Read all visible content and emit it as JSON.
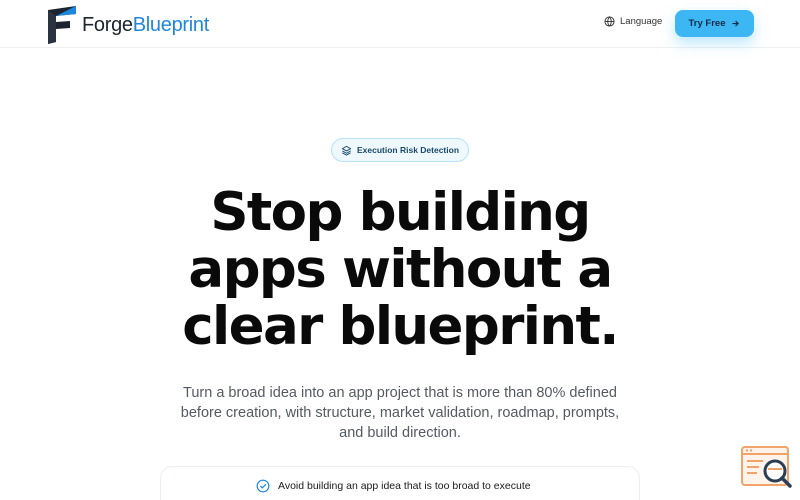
{
  "header": {
    "logo": {
      "part1": "Forge",
      "part2": "Blueprint"
    },
    "language_label": "Language",
    "cta_label": "Try Free"
  },
  "hero": {
    "badge_label": "Execution Risk Detection",
    "headline_lines": [
      "Stop building",
      "apps without a",
      "clear blueprint."
    ],
    "subtext_lines": [
      "Turn a broad idea into an app project that is more than 80% defined",
      "before creation, with structure, market validation, roadmap, prompts,",
      "and build direction."
    ]
  },
  "features": {
    "items": [
      "Avoid building an app idea that is too broad to execute"
    ]
  },
  "colors": {
    "brand_blue": "#1b88dd",
    "cta_blue": "#3db6f4",
    "badge_bg": "#eef8fd",
    "widget_orange": "#f0a46a"
  },
  "icons": {
    "language": "globe-icon",
    "cta_arrow": "arrow-right-icon",
    "badge": "layers-icon",
    "feature_check": "check-circle-icon",
    "widget": "search-window-icon"
  }
}
